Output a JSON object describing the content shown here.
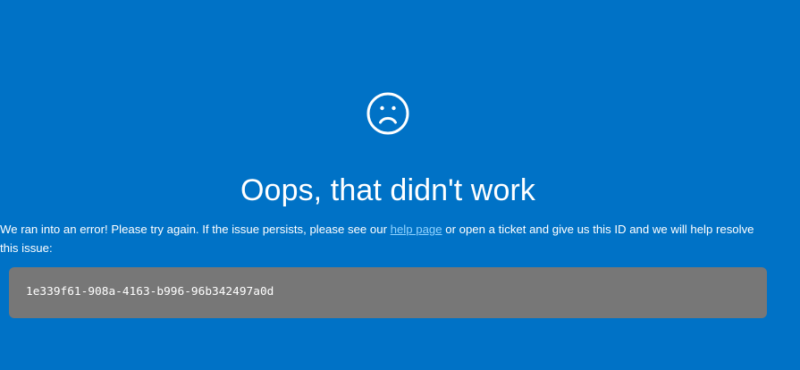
{
  "error": {
    "icon": "sad-face-icon",
    "title": "Oops, that didn't work",
    "message_before_link": "We ran into an error! Please try again. If the issue persists, please see our ",
    "help_link_label": "help page",
    "message_after_link": " or open a ticket and give us this ID and we will help resolve this issue:",
    "id": "1e339f61-908a-4163-b996-96b342497a0d"
  },
  "colors": {
    "background": "#0072c6",
    "text": "#ffffff",
    "link": "#8ed2ff",
    "id_box": "#777777"
  }
}
